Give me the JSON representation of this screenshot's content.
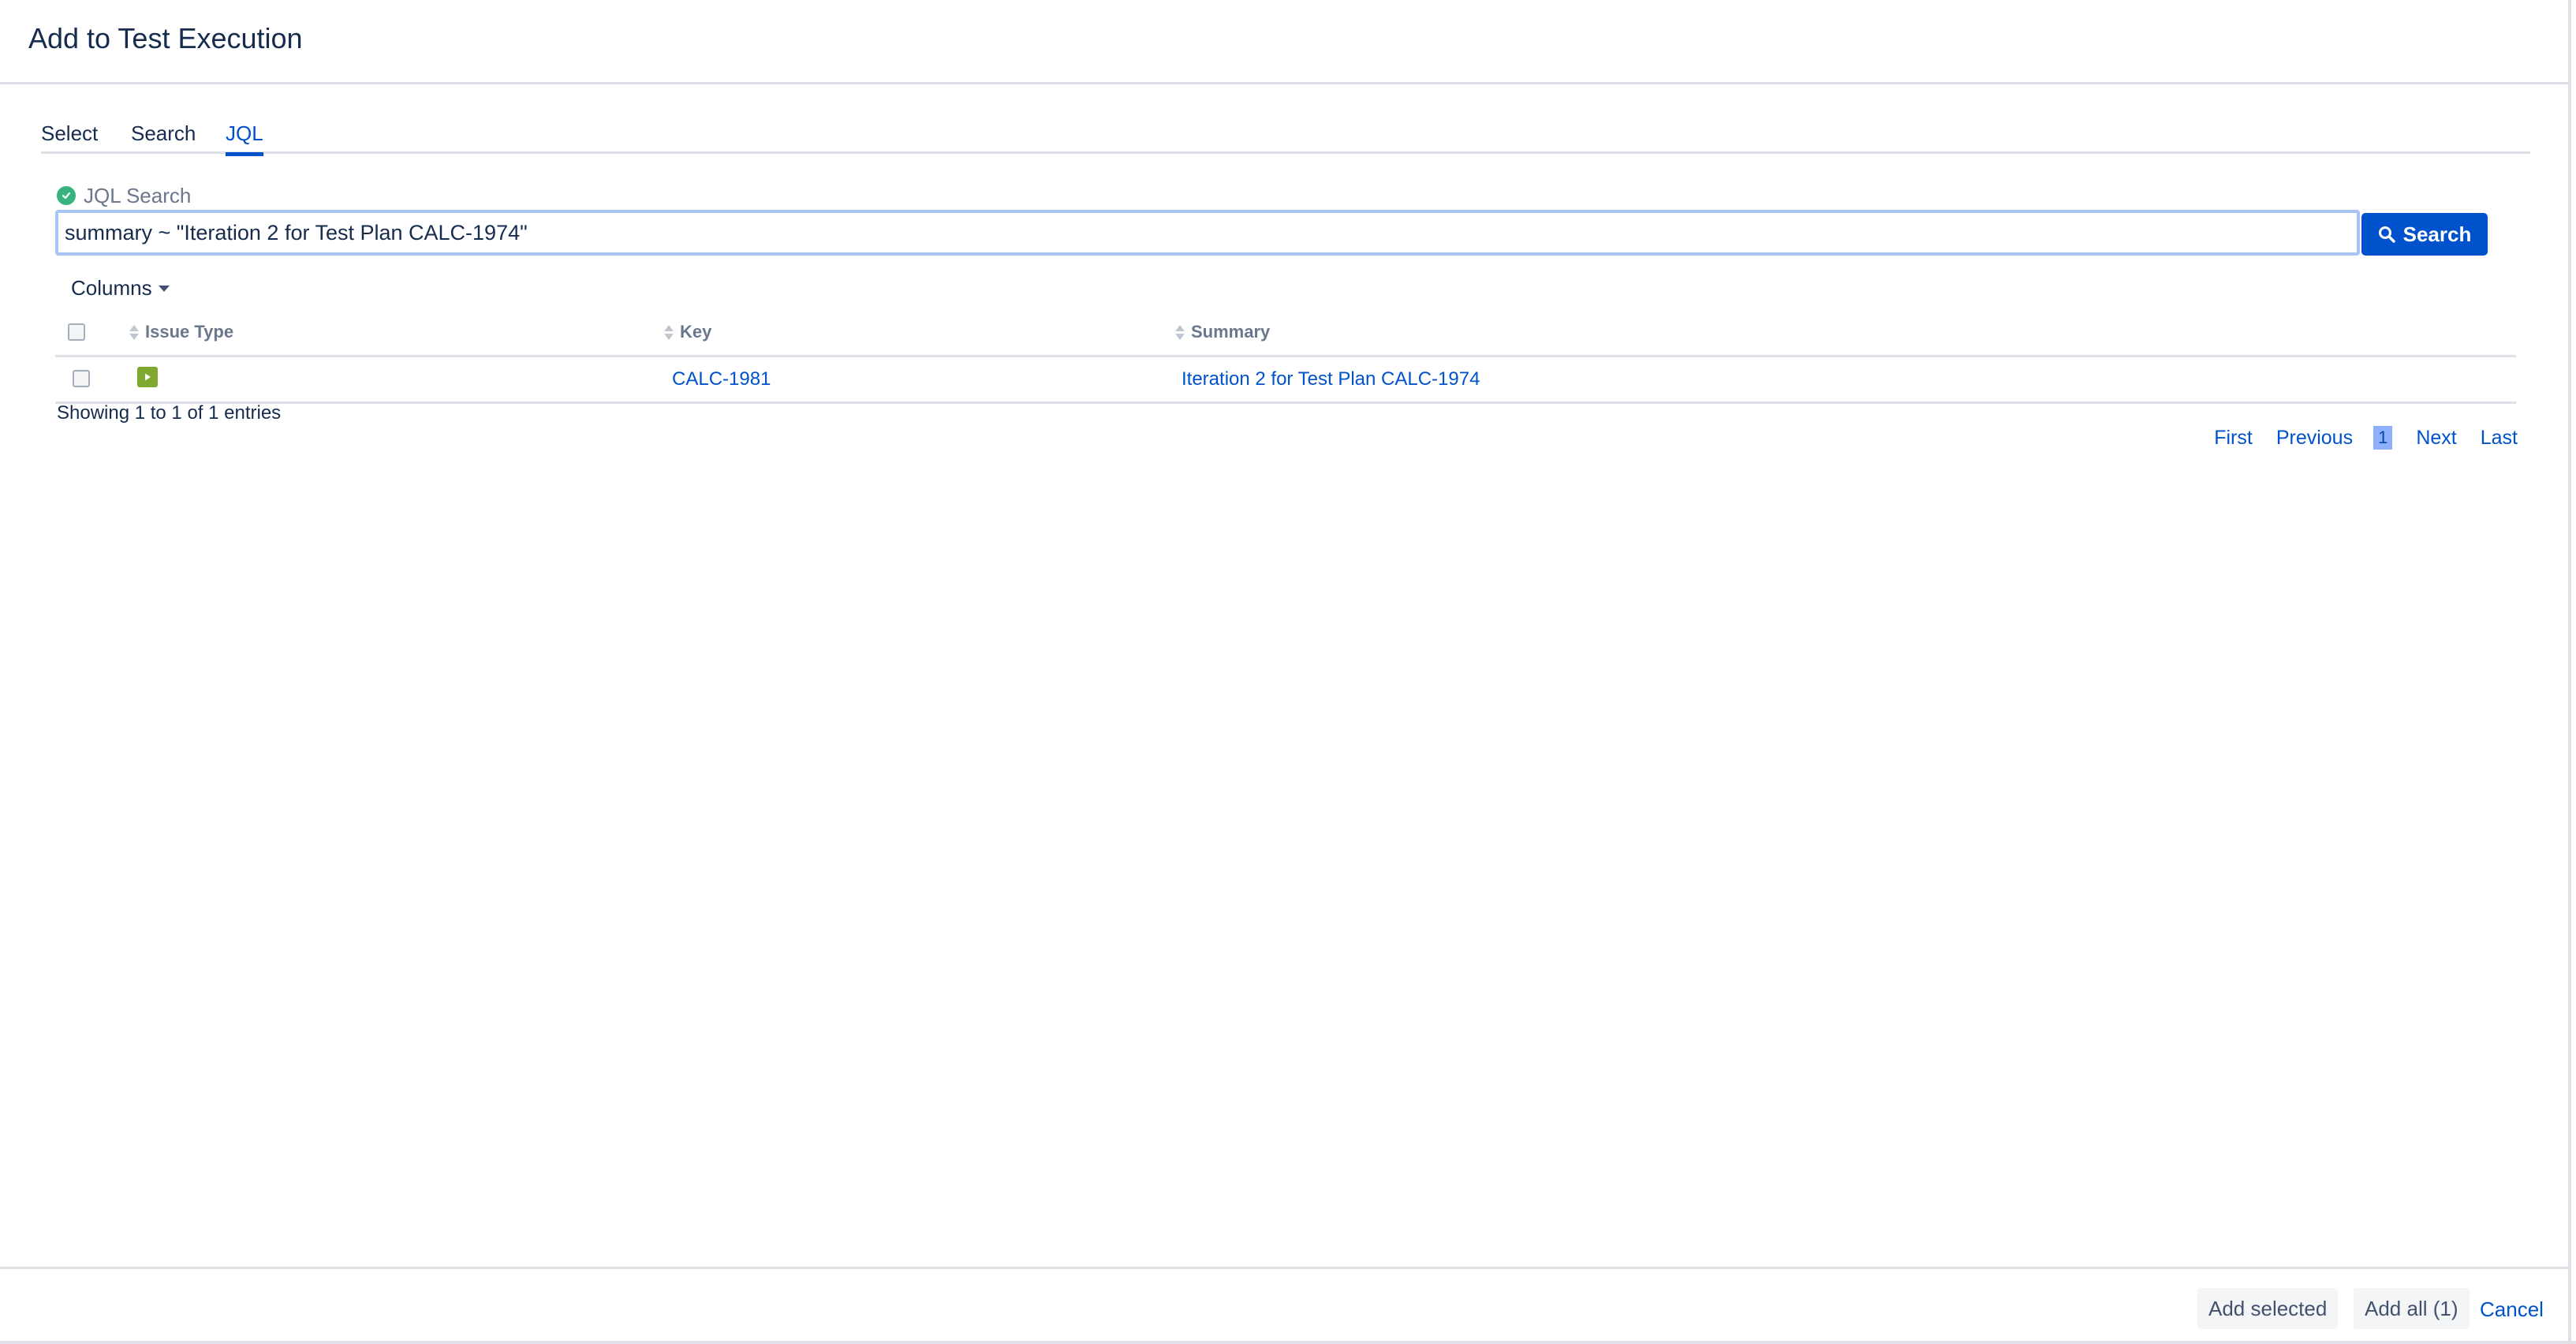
{
  "dialog": {
    "title": "Add to Test Execution"
  },
  "tabs": [
    {
      "label": "Select",
      "active": false
    },
    {
      "label": "Search",
      "active": false
    },
    {
      "label": "JQL",
      "active": true
    }
  ],
  "jql": {
    "status_icon": "check-circle-icon",
    "label": "JQL Search",
    "query": "summary ~ \"Iteration 2 for Test Plan CALC-1974\"",
    "search_button_label": "Search",
    "search_icon": "magnifier-icon"
  },
  "columns_toggle": {
    "label": "Columns"
  },
  "table": {
    "headers": {
      "issue_type": "Issue Type",
      "key": "Key",
      "summary": "Summary"
    },
    "rows": [
      {
        "issue_type_icon": "test-execution-icon",
        "key": "CALC-1981",
        "summary": "Iteration 2 for Test Plan CALC-1974"
      }
    ]
  },
  "info": {
    "showing": "Showing 1 to 1 of 1 entries"
  },
  "pagination": {
    "first": "First",
    "previous": "Previous",
    "current": "1",
    "next": "Next",
    "last": "Last"
  },
  "footer": {
    "add_selected": "Add selected",
    "add_all": "Add all (1)",
    "cancel": "Cancel"
  },
  "colors": {
    "primary": "#0052cc",
    "success": "#36b37e",
    "issue_icon": "#7ea830",
    "focus_border": "#a7c4f2"
  }
}
